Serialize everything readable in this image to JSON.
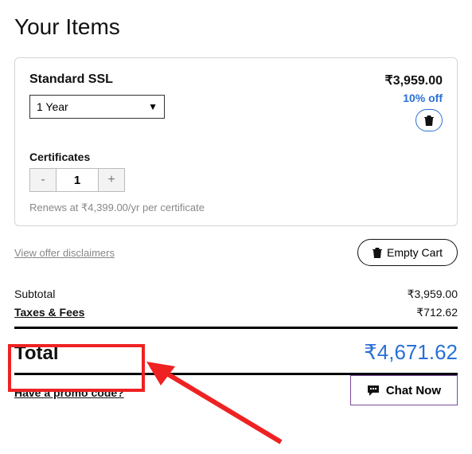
{
  "page": {
    "title": "Your Items"
  },
  "item": {
    "name": "Standard SSL",
    "term_selected": "1 Year",
    "price": "₹3,959.00",
    "discount": "10% off",
    "cert_label": "Certificates",
    "qty": "1",
    "renew_note": "Renews at ₹4,399.00/yr per certificate"
  },
  "links": {
    "disclaimer": "View offer disclaimers",
    "promo": "Have a promo code?"
  },
  "buttons": {
    "empty_cart": "Empty Cart",
    "chat": "Chat Now",
    "minus": "-",
    "plus": "+"
  },
  "totals": {
    "subtotal_label": "Subtotal",
    "subtotal_value": "₹3,959.00",
    "taxes_label": "Taxes & Fees",
    "taxes_value": "₹712.62",
    "total_label": "Total",
    "total_value": "₹4,671.62"
  }
}
